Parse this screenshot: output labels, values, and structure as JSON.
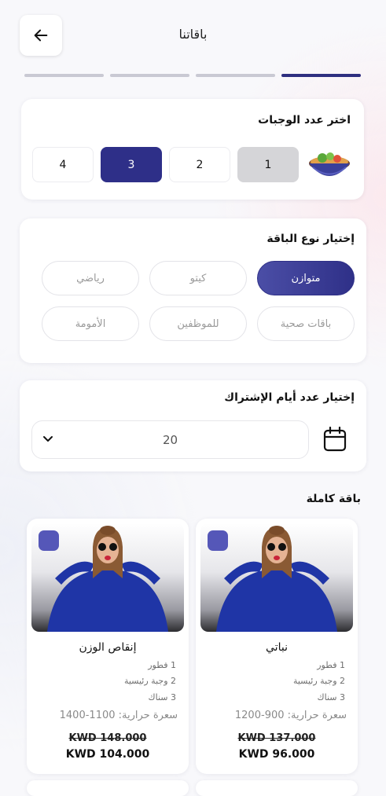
{
  "header": {
    "title": "باقاتنا"
  },
  "meals": {
    "title": "اختر عدد الوجبات",
    "options": [
      "4",
      "3",
      "2",
      "1"
    ]
  },
  "package_type": {
    "title": "إختيار نوع الباقة",
    "row1": [
      "رياضي",
      "كيتو",
      "متوازن"
    ],
    "row2": [
      "الأمومة",
      "للموظفين",
      "باقات صحية"
    ]
  },
  "days": {
    "title": "إختيار عدد أيام الإشتراك",
    "value": "20"
  },
  "plans": {
    "title": "باقة كاملة",
    "items": [
      {
        "name": "نباتي",
        "line1": "1 فطور",
        "line2": "2 وجبة رئيسية",
        "line3": "3 سناك",
        "calories": "سعرة حرارية: 900-1200",
        "old_price": "KWD 137.000",
        "new_price": "KWD 96.000"
      },
      {
        "name": "إنقاص الوزن",
        "line1": "1 فطور",
        "line2": "2 وجبة رئيسية",
        "line3": "3 سناك",
        "calories": "سعرة حرارية: 1100-1400",
        "old_price": "KWD 148.000",
        "new_price": "KWD 104.000"
      }
    ]
  },
  "colors": {
    "accent": "#2e2f88",
    "accent_light": "#5557b8",
    "selected_gray": "#d5d5d8"
  },
  "icons": [
    "arrow-left-icon",
    "food-bowl-icon",
    "calendar-icon",
    "chevron-down-icon"
  ]
}
